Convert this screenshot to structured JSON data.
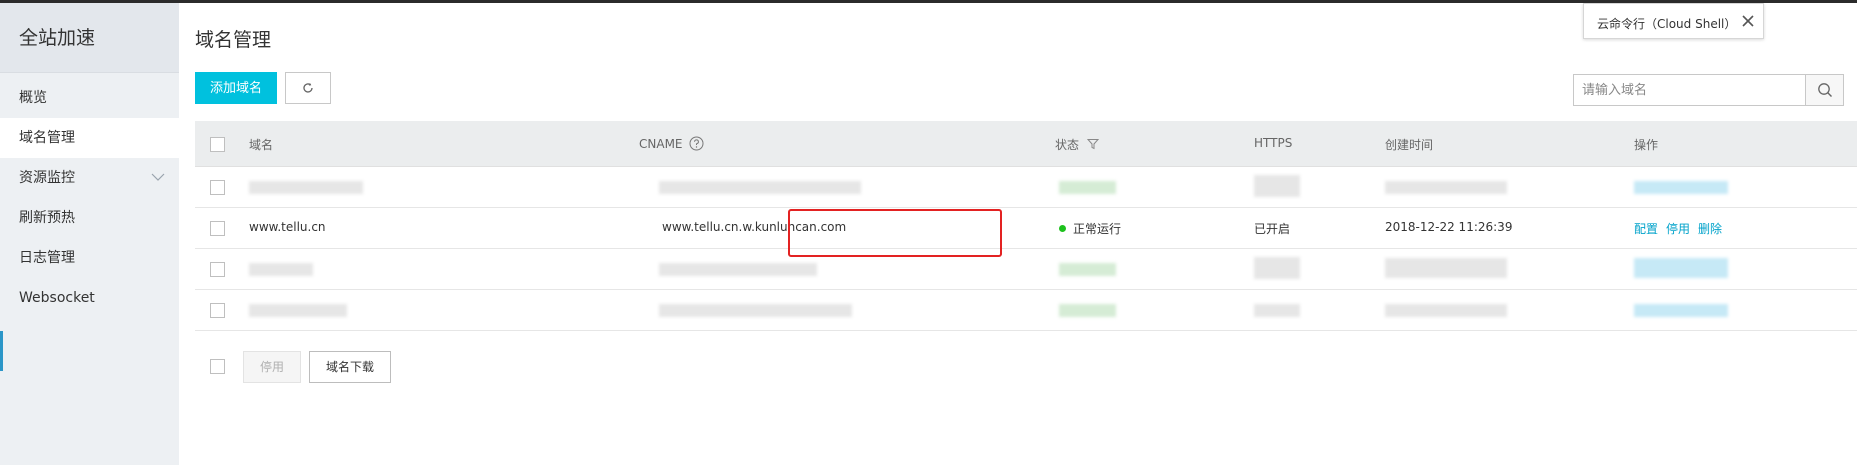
{
  "sidebar": {
    "title": "全站加速",
    "items": [
      {
        "label": "概览"
      },
      {
        "label": "域名管理",
        "active": true
      },
      {
        "label": "资源监控",
        "has_submenu": true
      },
      {
        "label": "刷新预热"
      },
      {
        "label": "日志管理"
      },
      {
        "label": "Websocket"
      }
    ]
  },
  "header": {
    "title": "域名管理",
    "add_button": "添加域名",
    "refresh_icon": "refresh-icon",
    "search_placeholder": "请输入域名",
    "search_icon": "search-icon"
  },
  "table": {
    "columns": {
      "domain": "域名",
      "cname": "CNAME",
      "status": "状态",
      "https": "HTTPS",
      "created": "创建时间",
      "actions": "操作"
    },
    "visible_row": {
      "domain": "www.tellu.cn",
      "cname": "www.tellu.cn.w.kunluncan.com",
      "status": "正常运行",
      "https": "已开启",
      "created": "2018-12-22 11:26:39",
      "actions": [
        "配置",
        "停用",
        "删除"
      ]
    }
  },
  "footer": {
    "disable_button": "停用",
    "download_button": "域名下载"
  },
  "tooltip": {
    "label": "云命令行（Cloud Shell）"
  },
  "colors": {
    "accent": "#00c1de",
    "link": "#00a2ca",
    "status_ok": "#1dc11d",
    "highlight": "#e32222"
  }
}
